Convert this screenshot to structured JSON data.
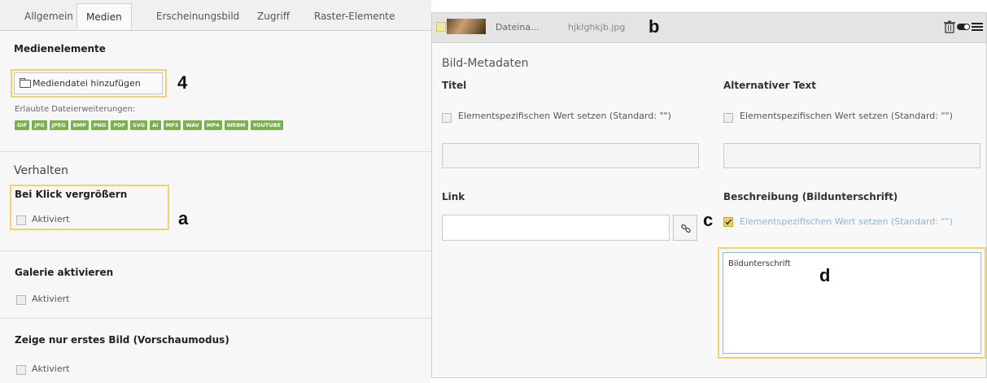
{
  "tabs": [
    {
      "label": "Allgemein"
    },
    {
      "label": "Medien"
    },
    {
      "label": "Erscheinungsbild"
    },
    {
      "label": "Zugriff"
    },
    {
      "label": "Raster-Elemente"
    }
  ],
  "media": {
    "section_title": "Medienelemente",
    "add_button_label": "Mediendatei hinzufügen",
    "allowed_label": "Erlaubte Dateierweiterungen:",
    "extensions": [
      "GIF",
      "JPG",
      "JPEG",
      "BMP",
      "PNG",
      "PDF",
      "SVG",
      "AI",
      "MP3",
      "WAV",
      "MP4",
      "WEBM",
      "YOUTUBE"
    ]
  },
  "behavior": {
    "heading": "Verhalten",
    "click_enlarge_title": "Bei Klick vergrößern",
    "click_enlarge_checkbox": "Aktiviert",
    "gallery_title": "Galerie aktivieren",
    "gallery_checkbox": "Aktiviert",
    "first_image_title": "Zeige nur erstes Bild (Vorschaumodus)",
    "first_image_checkbox": "Aktiviert"
  },
  "file_header": {
    "name_truncated": "Dateina...",
    "filename": "hjklghkjb.jpg",
    "icons": [
      "trash-icon",
      "toggle-icon",
      "menu-icon"
    ]
  },
  "metadata": {
    "title": "Bild-Metadaten",
    "titel_label": "Titel",
    "titel_checkbox_text": "Elementspezifischen Wert setzen (Standard: \"\")",
    "alt_label": "Alternativer Text",
    "alt_checkbox_text": "Elementspezifischen Wert setzen (Standard: \"\")",
    "link_label": "Link",
    "caption_label": "Beschreibung (Bildunterschrift)",
    "caption_checkbox_text": "Elementspezifischen Wert setzen (Standard: \"\")",
    "caption_value": "Bildunterschrift"
  },
  "annotations": {
    "four": "4",
    "a": "a",
    "b": "b",
    "c": "c",
    "d": "d"
  },
  "colors": {
    "callout": "#f0d36c",
    "ext_badge": "#7bb051"
  }
}
